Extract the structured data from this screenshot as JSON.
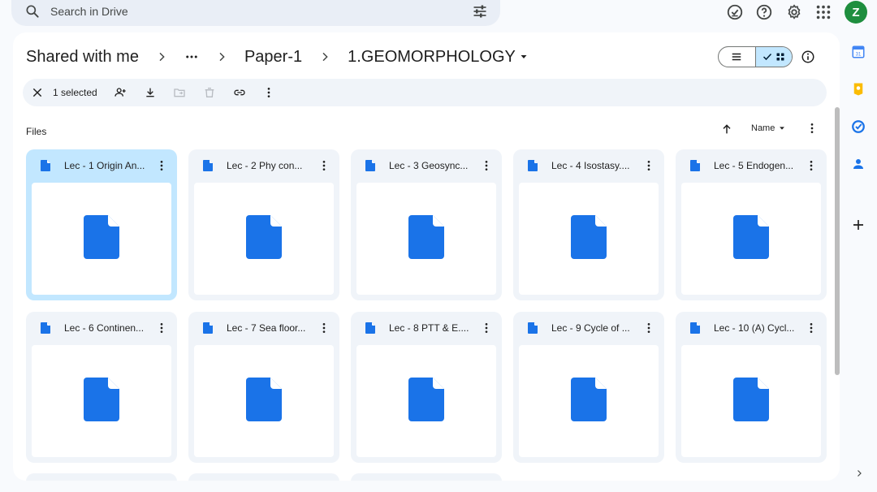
{
  "search": {
    "placeholder": "Search in Drive",
    "icon": "search-icon",
    "filter_icon": "tune-icon"
  },
  "topbar": {
    "icons": [
      "ready-for-offline-icon",
      "help-icon",
      "settings-icon",
      "apps-grid-icon"
    ],
    "avatar_letter": "Z",
    "avatar_color": "#1e8e3e"
  },
  "breadcrumb": {
    "items": [
      "Shared with me",
      "Paper-1",
      "1.GEOMORPHOLOGY"
    ]
  },
  "actions": {
    "selected_text": "1 selected"
  },
  "files": {
    "section_label": "Files",
    "sort_label": "Name",
    "items": [
      {
        "name": "Lec - 1 Origin An...",
        "selected": true
      },
      {
        "name": "Lec - 2 Phy con...",
        "selected": false
      },
      {
        "name": "Lec - 3 Geosync...",
        "selected": false
      },
      {
        "name": "Lec - 4 Isostasy....",
        "selected": false
      },
      {
        "name": "Lec - 5 Endogen...",
        "selected": false
      },
      {
        "name": "Lec - 6 Continen...",
        "selected": false
      },
      {
        "name": "Lec - 7 Sea floor...",
        "selected": false
      },
      {
        "name": "Lec - 8 PTT & E....",
        "selected": false
      },
      {
        "name": "Lec - 9 Cycle of ...",
        "selected": false
      },
      {
        "name": "Lec - 10 (A) Cycl...",
        "selected": false
      }
    ]
  },
  "colors": {
    "accent": "#1a73e8",
    "selected_card": "#c2e7ff",
    "card_bg": "#f0f4f9",
    "page_bg": "#f8fafd"
  },
  "right_rail": {
    "icons": [
      "calendar-icon",
      "keep-icon",
      "tasks-icon",
      "contacts-icon",
      "add-icon",
      "chevron-right-icon"
    ],
    "calendar_day": "31"
  }
}
